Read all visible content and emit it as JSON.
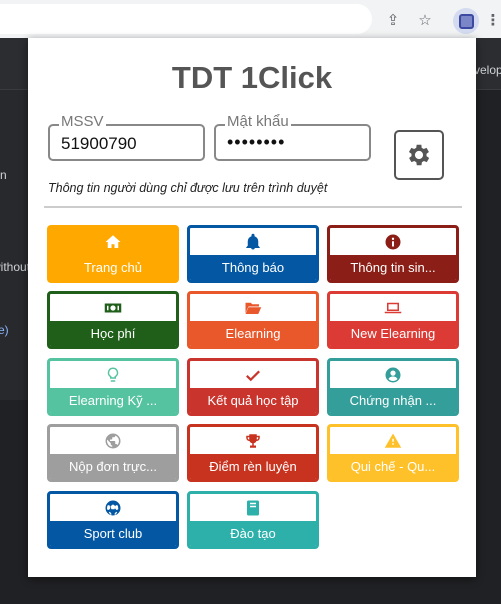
{
  "browser": {
    "icons": [
      "share-icon",
      "star-icon",
      "extension-icon",
      "more-icon"
    ]
  },
  "background": {
    "snippets": [
      "velop",
      "vn",
      "without",
      "i",
      "e)"
    ]
  },
  "popup": {
    "title": "TDT 1Click",
    "mssv": {
      "label": "MSSV",
      "value": "51900790"
    },
    "password": {
      "label": "Mật khẩu",
      "value": "••••••••"
    },
    "settings_icon": "gear-icon",
    "note": "Thông tin người dùng chỉ được lưu trên trình duyệt",
    "tiles": [
      {
        "label": "Trang chủ",
        "icon": "home-icon",
        "color": "#FFA900",
        "active": true
      },
      {
        "label": "Thông báo",
        "icon": "bell-icon",
        "color": "#0357A3"
      },
      {
        "label": "Thông tin sin...",
        "icon": "info-icon",
        "color": "#8B1E16"
      },
      {
        "label": "Học phí",
        "icon": "money-icon",
        "color": "#1F5F1A"
      },
      {
        "label": "Elearning",
        "icon": "folder-icon",
        "color": "#E8582B"
      },
      {
        "label": "New Elearning",
        "icon": "laptop-icon",
        "color": "#DB3A35"
      },
      {
        "label": "Elearning Kỹ ...",
        "icon": "lightbulb-icon",
        "color": "#55C3A0"
      },
      {
        "label": "Kết quả học tập",
        "icon": "check-icon",
        "color": "#C9342D"
      },
      {
        "label": "Chứng nhận ...",
        "icon": "user-circle-icon",
        "color": "#339E9A"
      },
      {
        "label": "Nộp đơn trực...",
        "icon": "globe-icon",
        "color": "#9E9E9E"
      },
      {
        "label": "Điểm rèn luyện",
        "icon": "trophy-icon",
        "color": "#C7331F"
      },
      {
        "label": "Qui chế - Qu...",
        "icon": "warning-icon",
        "color": "#FFC12A"
      },
      {
        "label": "Sport club",
        "icon": "soccer-ball-icon",
        "color": "#0357A3"
      },
      {
        "label": "Đào tạo",
        "icon": "book-icon",
        "color": "#2EB0AA"
      }
    ]
  }
}
